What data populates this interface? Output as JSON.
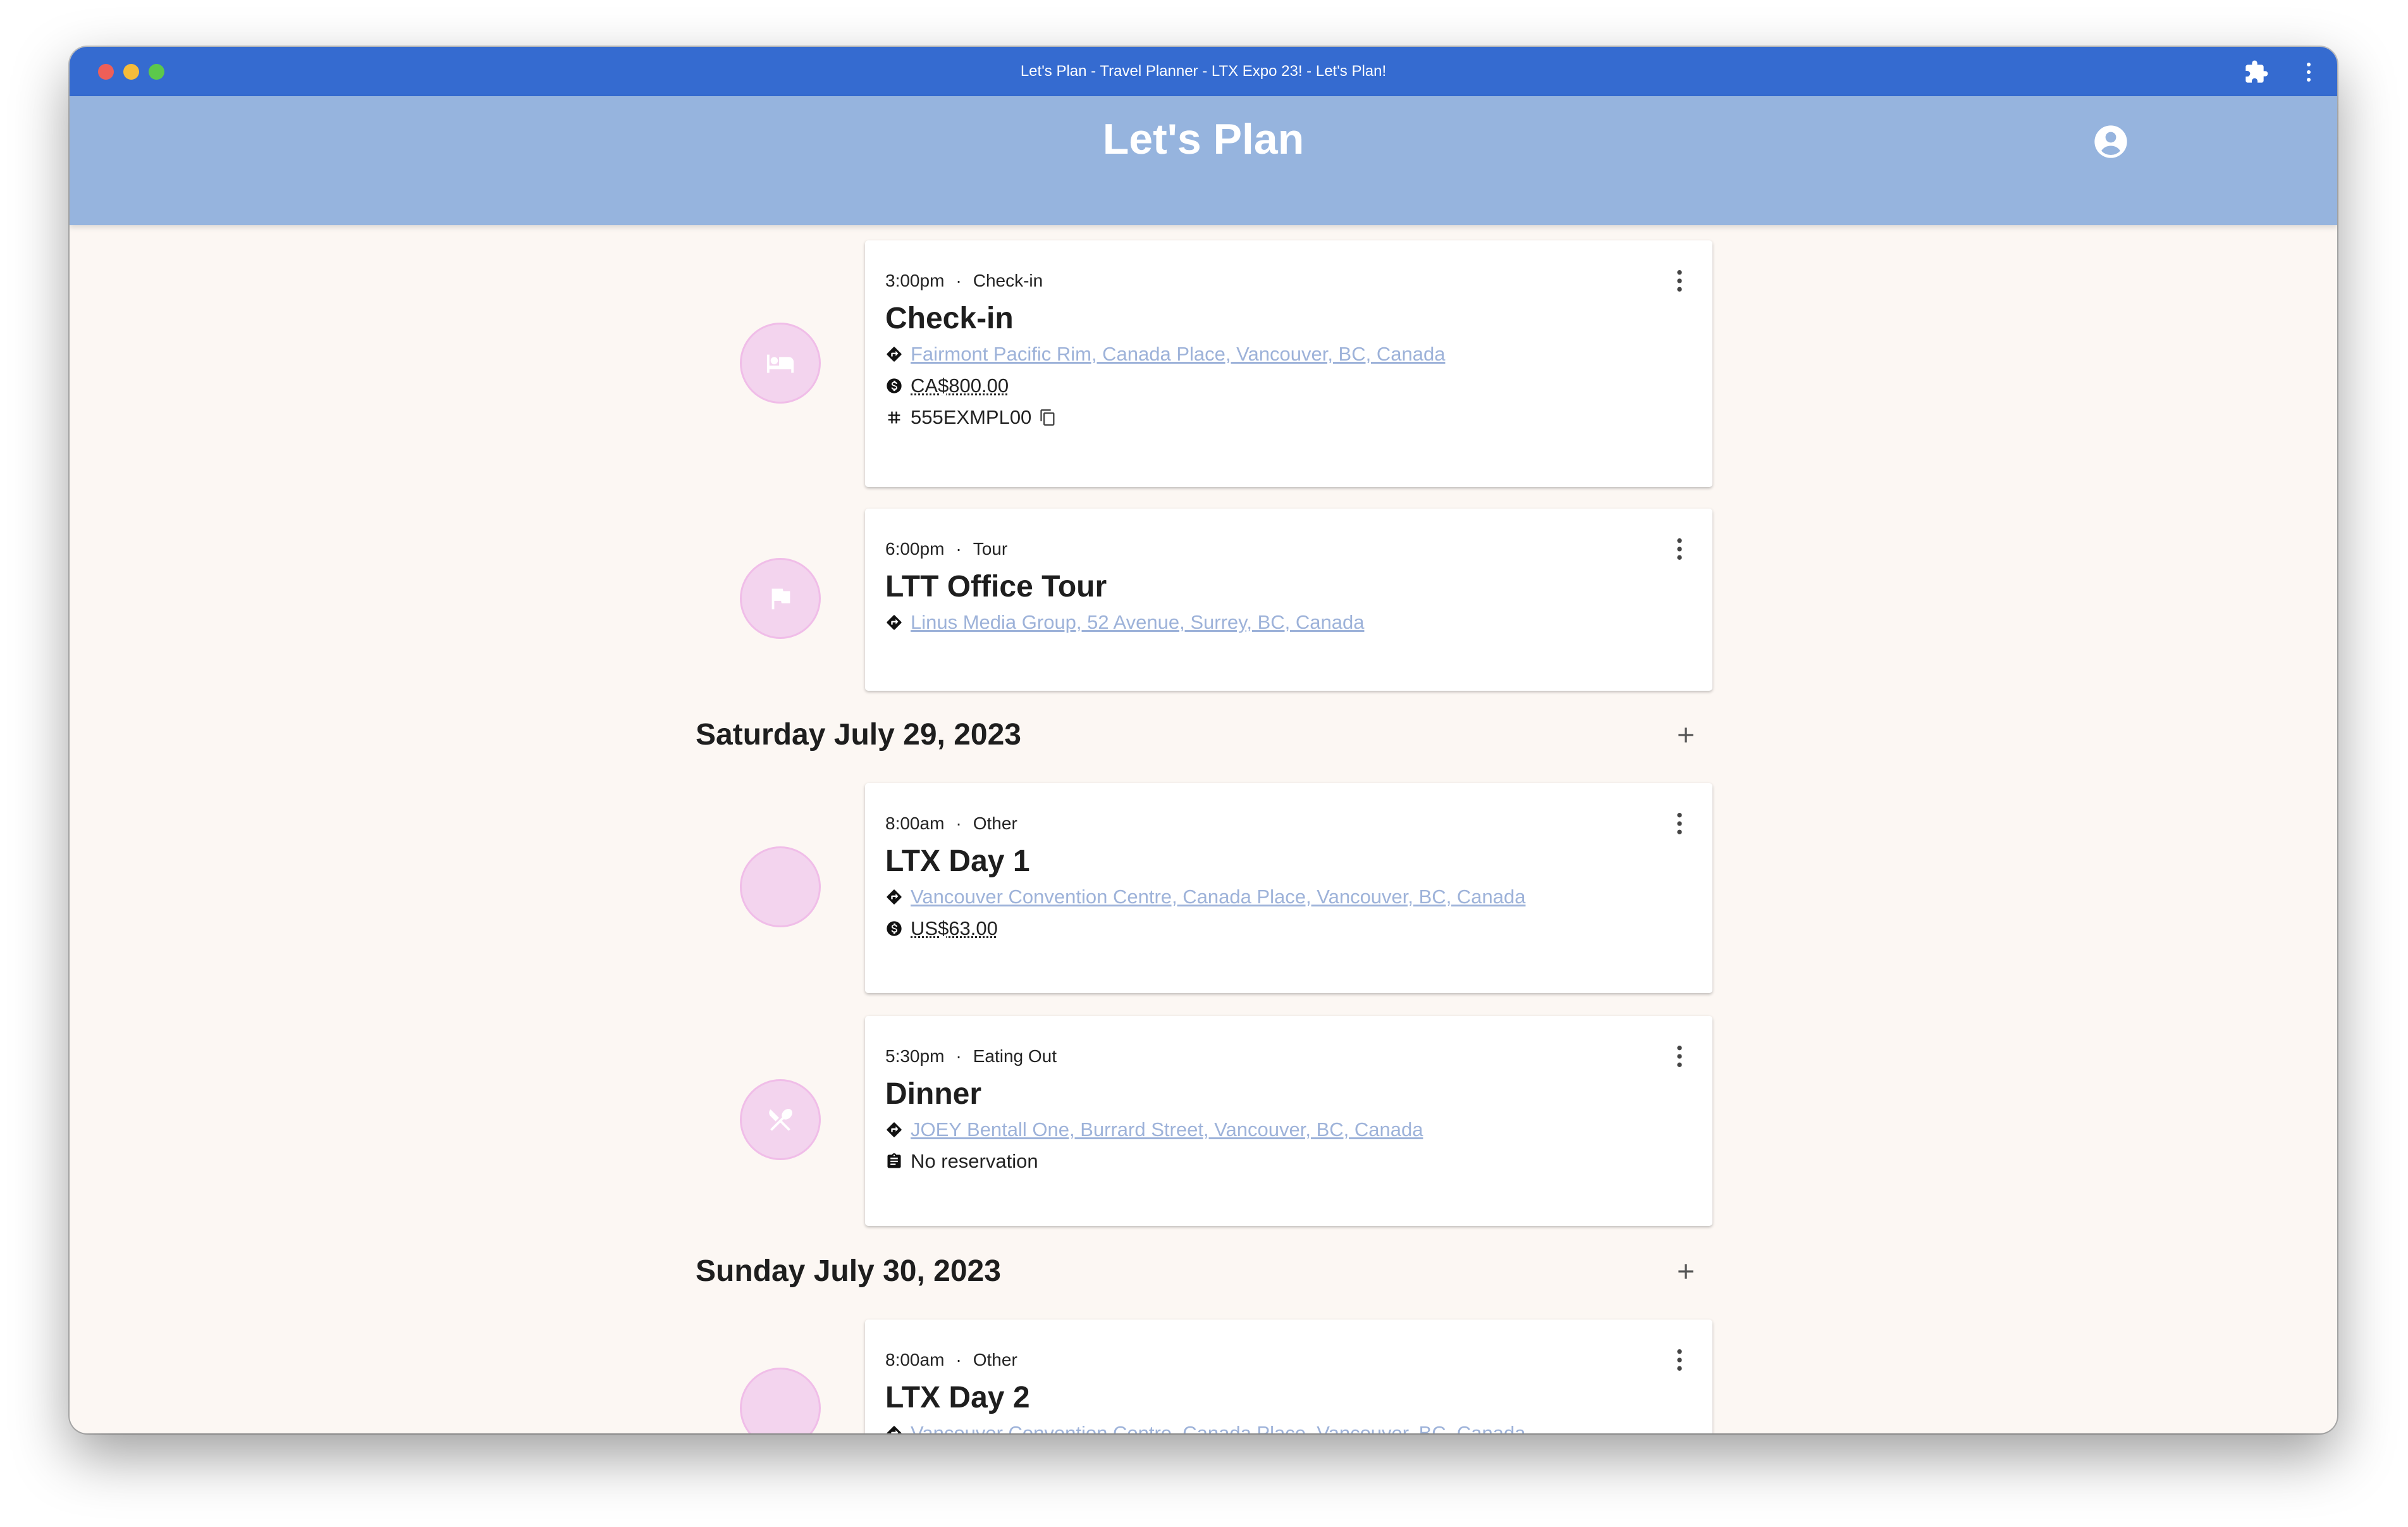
{
  "window": {
    "title": "Let's Plan - Travel Planner - LTX Expo 23! - Let's Plan!"
  },
  "app": {
    "brand": "Let's Plan"
  },
  "days": {
    "d1": {
      "label": "Saturday July 29, 2023"
    },
    "d2": {
      "label": "Sunday July 30, 2023"
    }
  },
  "events": {
    "e1": {
      "time": "3:00pm",
      "category": "Check-in",
      "title": "Check-in",
      "location": "Fairmont Pacific Rim, Canada Place, Vancouver, BC, Canada",
      "cost": "CA$800.00",
      "confirmation": "555EXMPL00",
      "icon": "hotel-icon"
    },
    "e2": {
      "time": "6:00pm",
      "category": "Tour",
      "title": "LTT Office Tour",
      "location": "Linus Media Group, 52 Avenue, Surrey, BC, Canada",
      "icon": "tour-flag-icon"
    },
    "e3": {
      "time": "8:00am",
      "category": "Other",
      "title": "LTX Day 1",
      "location": "Vancouver Convention Centre, Canada Place, Vancouver, BC, Canada",
      "cost": "US$63.00"
    },
    "e4": {
      "time": "5:30pm",
      "category": "Eating Out",
      "title": "Dinner",
      "location": "JOEY Bentall One, Burrard Street, Vancouver, BC, Canada",
      "reservation": "No reservation",
      "icon": "restaurant-icon"
    },
    "e5": {
      "time": "8:00am",
      "category": "Other",
      "title": "LTX Day 2",
      "location": "Vancouver Convention Centre, Canada Place, Vancouver, BC, Canada"
    }
  },
  "colors": {
    "titlebar": "#356bd0",
    "appbar": "#96b4de",
    "background": "#fcf7f3",
    "avatar_fill": "#f3d4ee",
    "link": "#9db2d9"
  }
}
